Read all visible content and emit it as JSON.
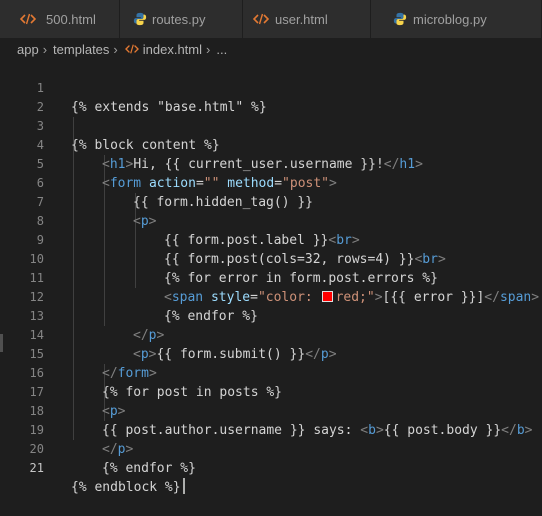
{
  "tabs": [
    {
      "label": "500.html",
      "icon": "html-tag-icon"
    },
    {
      "label": "routes.py",
      "icon": "python-icon"
    },
    {
      "label": "user.html",
      "icon": "html-tag-icon"
    },
    {
      "label": "microblog.py",
      "icon": "python-icon"
    }
  ],
  "breadcrumb": {
    "items": [
      "app",
      "templates",
      "index.html",
      "..."
    ]
  },
  "colors": {
    "html_icon": "#e37933",
    "python_blue": "#3572a5",
    "python_yellow": "#f7d44c"
  },
  "lines": [
    {
      "num": "1",
      "t1": "{% extends \"base.html\" %}"
    },
    {
      "num": "2"
    },
    {
      "num": "3",
      "t1": "{% block content %}"
    },
    {
      "num": "4",
      "t1": "<",
      "t2": "h1",
      "t3": ">",
      "t4": "Hi, {{ current_user.username }}!",
      "t5": "</",
      "t6": "h1",
      "t7": ">"
    },
    {
      "num": "5",
      "t1": "<",
      "t2": "form",
      "t3": " action",
      "t4": "=",
      "t5": "\"\"",
      "t6": " method",
      "t7": "=",
      "t8": "\"post\"",
      "t9": ">"
    },
    {
      "num": "6",
      "t1": "{{ form.hidden_tag() }}"
    },
    {
      "num": "7",
      "t1": "<",
      "t2": "p",
      "t3": ">"
    },
    {
      "num": "8",
      "t1": "{{ form.post.label }}",
      "t2": "<",
      "t3": "br",
      "t4": ">"
    },
    {
      "num": "9",
      "t1": "{{ form.post(cols=32, rows=4) }}",
      "t2": "<",
      "t3": "br",
      "t4": ">"
    },
    {
      "num": "10",
      "t1": "{% for error in form.post.errors %}"
    },
    {
      "num": "11",
      "t1": "<",
      "t2": "span",
      "t3": " style",
      "t4": "=",
      "t5": "\"color: ",
      "t6": "red;\"",
      "t7": ">",
      "t8": "[{{ error }}]",
      "t9": "</",
      "t10": "span",
      "t11": ">"
    },
    {
      "num": "12",
      "t1": "{% endfor %}"
    },
    {
      "num": "13",
      "t1": "</",
      "t2": "p",
      "t3": ">"
    },
    {
      "num": "14",
      "t1": "<",
      "t2": "p",
      "t3": ">",
      "t4": "{{ form.submit() }}",
      "t5": "</",
      "t6": "p",
      "t7": ">"
    },
    {
      "num": "15",
      "t1": "</",
      "t2": "form",
      "t3": ">"
    },
    {
      "num": "16",
      "t1": "{% for post in posts %}"
    },
    {
      "num": "17",
      "t1": "<",
      "t2": "p",
      "t3": ">"
    },
    {
      "num": "18",
      "t1": "{{ post.author.username }} says: ",
      "t2": "<",
      "t3": "b",
      "t4": ">",
      "t5": "{{ post.body }}",
      "t6": "</",
      "t7": "b",
      "t8": ">"
    },
    {
      "num": "19",
      "t1": "</",
      "t2": "p",
      "t3": ">"
    },
    {
      "num": "20",
      "t1": "{% endfor %}"
    },
    {
      "num": "21",
      "t1": "{% endblock %}"
    }
  ]
}
